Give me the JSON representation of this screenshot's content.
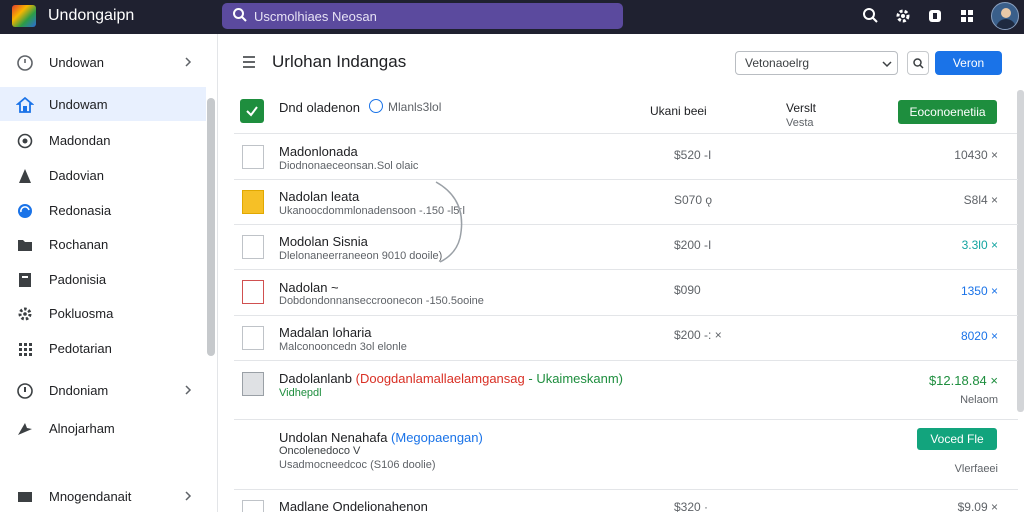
{
  "app": {
    "title": "Undongaipn",
    "search_placeholder": "Uscmolhiaes Neosan"
  },
  "topbar_icons": [
    "search-icon",
    "gear-icon",
    "notifications-icon",
    "apps-grid-icon",
    "avatar"
  ],
  "sidebar": {
    "items": [
      {
        "label": "Undowan",
        "icon": "clock-icon",
        "chevron": true,
        "active": false
      },
      {
        "label": "Undowam",
        "icon": "home-icon",
        "chevron": false,
        "active": true
      },
      {
        "label": "Madondan",
        "icon": "target-icon",
        "chevron": false,
        "active": false
      },
      {
        "label": "Dadovian",
        "icon": "user-icon",
        "chevron": false,
        "active": false
      },
      {
        "label": "Redonasia",
        "icon": "blue-circle-icon",
        "chevron": false,
        "active": false
      },
      {
        "label": "Rochanan",
        "icon": "folder-icon",
        "chevron": false,
        "active": false
      },
      {
        "label": "Padonisia",
        "icon": "document-icon",
        "chevron": false,
        "active": false
      },
      {
        "label": "Pokluosma",
        "icon": "settings-cog-icon",
        "chevron": false,
        "active": false
      },
      {
        "label": "Pedotarian",
        "icon": "grid-icon",
        "chevron": false,
        "active": false
      },
      {
        "label": "Dndoniam",
        "icon": "info-circle-icon",
        "chevron": true,
        "active": false
      },
      {
        "label": "Alnojarham",
        "icon": "arrow-icon",
        "chevron": false,
        "active": false
      },
      {
        "label": "Mnogendanait",
        "icon": "image-icon",
        "chevron": true,
        "active": false
      }
    ]
  },
  "main": {
    "title": "Urlohan Indangas",
    "select_value": "Vetonaoelrg",
    "primary_button": "Veron"
  },
  "list_header": {
    "label": "Dnd oladenon",
    "count": "Mlanls3lol",
    "col1": "Ukani beei",
    "col2": "Verslt",
    "col2_sub": "Vesta",
    "button": "Eoconoenetiia"
  },
  "rows": [
    {
      "title": "Madonlonada",
      "subtitle": "Diodnonaeceonsan.Sol olaic",
      "price": "$520 -I",
      "amount": "10430 ×"
    },
    {
      "title": "Nadolan leata",
      "subtitle": "Ukanoocdommlonadensoon -.150 -l5:l",
      "price": "S070 ǫ",
      "amount": "S8l4 ×"
    },
    {
      "title": "Modolan Sisnia",
      "subtitle": "Dlelonaneerraneeon 9010 dooile)",
      "price": "$200 -I",
      "amount": "3.3l0 ×"
    },
    {
      "title": "Nadolan ~",
      "subtitle": "Dobdondonnanseccroonecon -150.5ooine",
      "price": "$090",
      "amount": "1350 ×"
    },
    {
      "title": "Madalan loharia",
      "subtitle": "Malconooncedn 3ol elonle",
      "price": "$200 -: ×",
      "amount": "8020 ×"
    },
    {
      "title": "Dadolanlanb",
      "tag_red": "(Doogdanlamallaelamgansag",
      "tag_green": "-  Ukaimeskanm)",
      "subtitle": "Vidhepdl",
      "amount": "$12.18.84 ×",
      "note": "Nelaom"
    },
    {
      "title": "Undolan Nenahafa",
      "tag_blue": "(Megopaengan)",
      "subtitle": "Oncolenedoco V",
      "subtitle2": "Usadmocneedcoc (S106 doolie)",
      "button": "Voced Fle",
      "note": "Vlerfaeei"
    },
    {
      "title": "Madlane Ondelionahenon",
      "price": "$320 ·",
      "amount": "$9.09 ×"
    }
  ]
}
